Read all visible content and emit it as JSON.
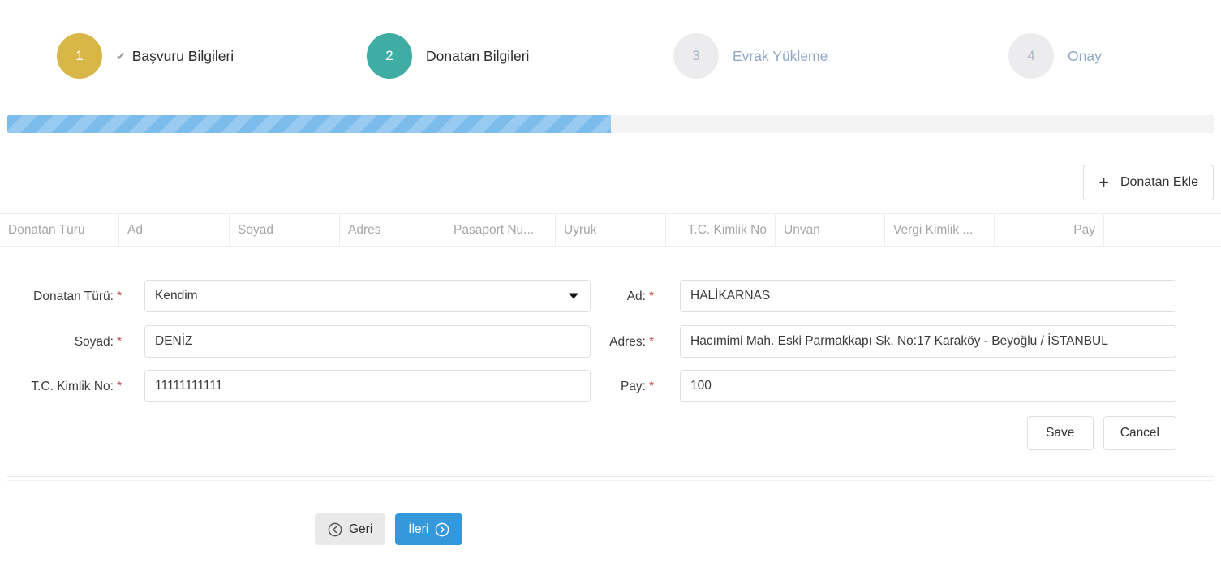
{
  "wizard": {
    "steps": [
      {
        "number": "1",
        "label": "Başvuru Bilgileri",
        "state": "completed",
        "check": "✔"
      },
      {
        "number": "2",
        "label": "Donatan Bilgileri",
        "state": "active"
      },
      {
        "number": "3",
        "label": "Evrak Yükleme",
        "state": "pending"
      },
      {
        "number": "4",
        "label": "Onay",
        "state": "pending"
      }
    ]
  },
  "progress": {
    "percent": 50,
    "fill_color": "#7cbcec",
    "track_color": "#f4f4f5"
  },
  "toolbar": {
    "add_donor_label": "Donatan Ekle",
    "plus_icon": "+"
  },
  "grid": {
    "columns": [
      "Donatan Türü",
      "Ad",
      "Soyad",
      "Adres",
      "Pasaport Nu...",
      "Uyruk",
      "T.C. Kimlik No",
      "Unvan",
      "Vergi Kimlik ...",
      "Pay",
      ""
    ]
  },
  "form": {
    "donor_type": {
      "label": "Donatan Türü:",
      "required": "*",
      "value": "Kendim"
    },
    "first_name": {
      "label": "Ad:",
      "required": "*",
      "value": "HALİKARNAS"
    },
    "last_name": {
      "label": "Soyad:",
      "required": "*",
      "value": "DENİZ"
    },
    "address": {
      "label": "Adres:",
      "required": "*",
      "value": "Hacımimi Mah. Eski Parmakkapı Sk. No:17 Karaköy - Beyoğlu / İSTANBUL"
    },
    "national_id": {
      "label": "T.C. Kimlik No:",
      "required": "*",
      "value": "11111111111"
    },
    "share": {
      "label": "Pay:",
      "required": "*",
      "value": "100"
    },
    "save_label": "Save",
    "cancel_label": "Cancel"
  },
  "navigation": {
    "back_label": "Geri",
    "next_label": "İleri",
    "back_icon": "arrow-left-circle-icon",
    "next_icon": "arrow-right-circle-icon"
  },
  "colors": {
    "step_completed": "#d9b648",
    "step_active": "#3fada3",
    "step_pending_bg": "#ececee",
    "pending_text": "#8ea9c7",
    "primary_button": "#3498db",
    "required_asterisk": "#c0504d"
  }
}
